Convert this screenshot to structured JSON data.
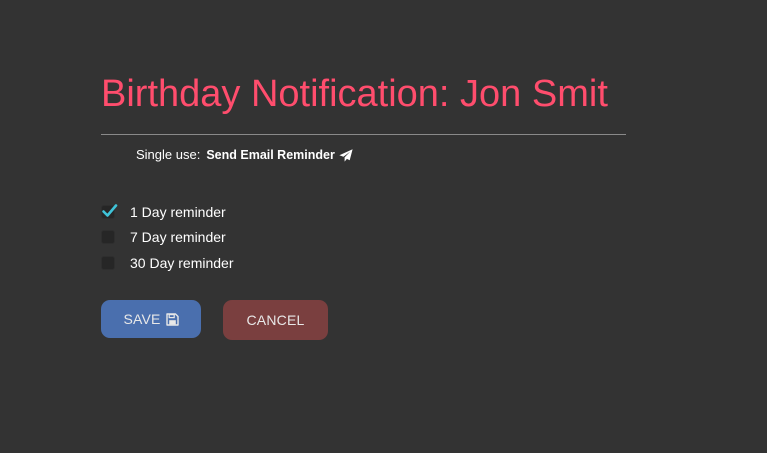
{
  "header": {
    "title": "Birthday Notification: Jon Smit"
  },
  "single_use": {
    "prefix": "Single use:",
    "link_label": "Send Email Reminder",
    "link_icon": "paper-plane-icon"
  },
  "reminders": [
    {
      "label": "1 Day reminder",
      "checked": true
    },
    {
      "label": "7 Day reminder",
      "checked": false
    },
    {
      "label": "30 Day reminder",
      "checked": false
    }
  ],
  "buttons": {
    "save_label": "SAVE",
    "save_icon": "floppy-disk-icon",
    "cancel_label": "CANCEL"
  },
  "colors": {
    "background": "#333333",
    "title": "#ff4d6d",
    "check": "#3fc3d8",
    "save_button": "#4a6fae",
    "cancel_button": "#7a3f3f"
  }
}
